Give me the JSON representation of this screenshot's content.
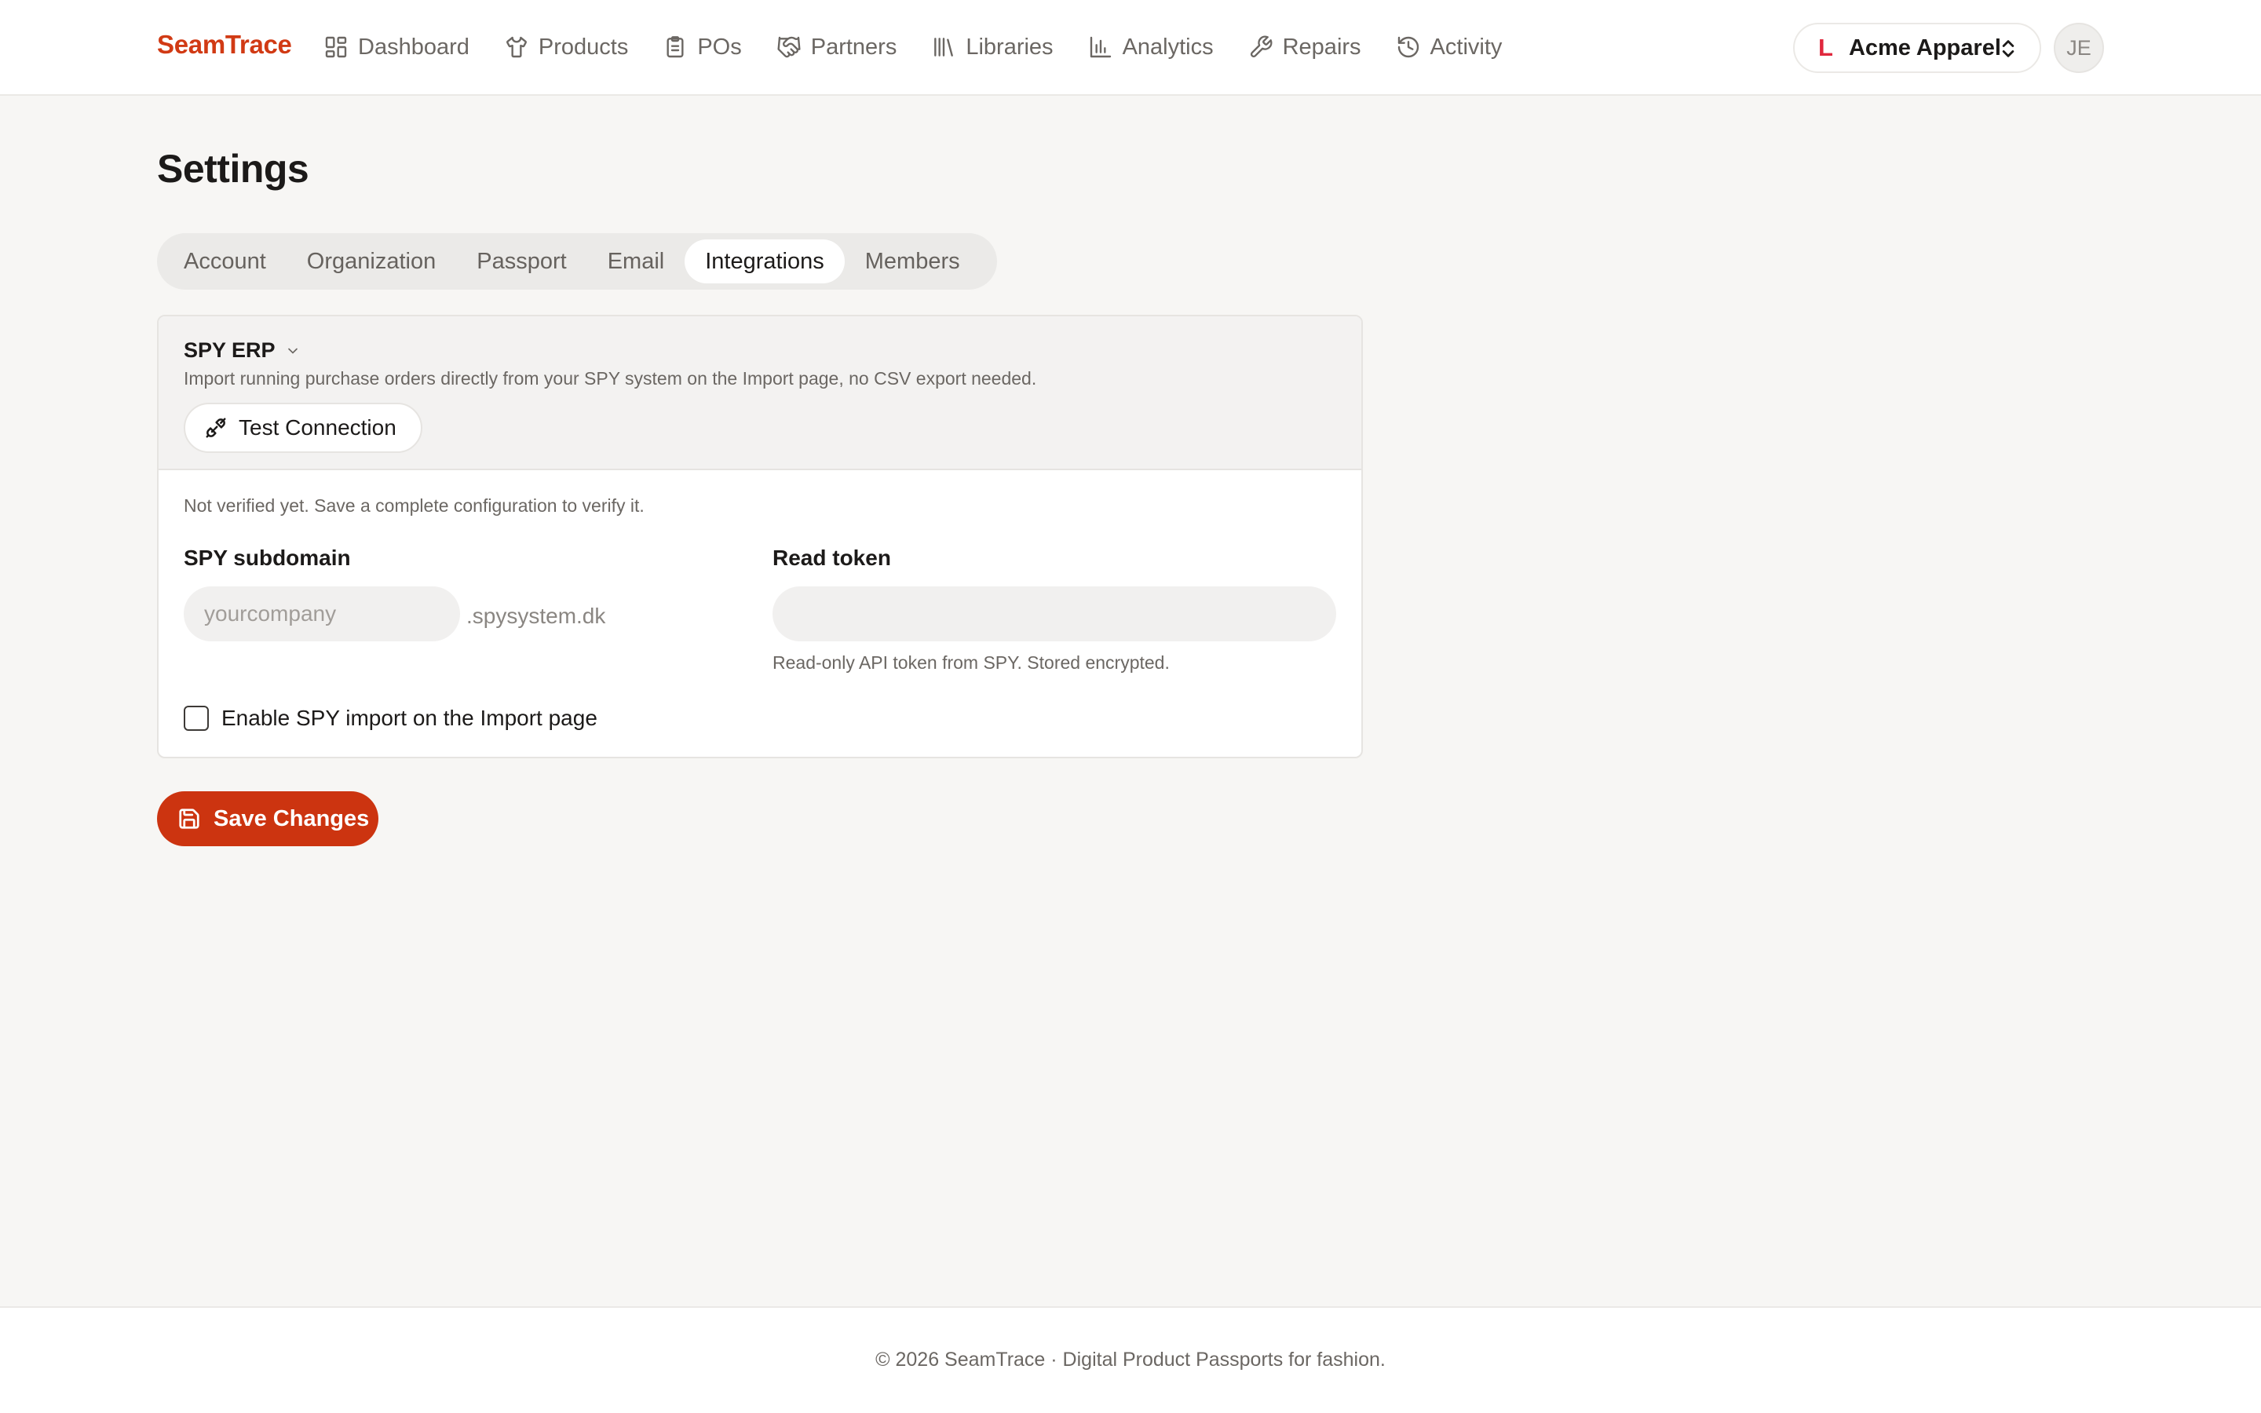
{
  "brand": {
    "name": "SeamTrace",
    "color": "#d13a14"
  },
  "nav": {
    "items": [
      {
        "label": "Dashboard",
        "icon": "dashboard-icon"
      },
      {
        "label": "Products",
        "icon": "shirt-icon"
      },
      {
        "label": "POs",
        "icon": "clipboard-icon"
      },
      {
        "label": "Partners",
        "icon": "handshake-icon"
      },
      {
        "label": "Libraries",
        "icon": "library-icon"
      },
      {
        "label": "Analytics",
        "icon": "bar-chart-icon"
      },
      {
        "label": "Repairs",
        "icon": "wrench-icon"
      },
      {
        "label": "Activity",
        "icon": "history-icon"
      }
    ]
  },
  "org": {
    "logo": "L",
    "name": "Acme Apparel"
  },
  "user": {
    "initials": "JE"
  },
  "page": {
    "title": "Settings"
  },
  "tabs": {
    "items": [
      {
        "label": "Account"
      },
      {
        "label": "Organization"
      },
      {
        "label": "Passport"
      },
      {
        "label": "Email"
      },
      {
        "label": "Integrations",
        "active": true
      },
      {
        "label": "Members"
      }
    ]
  },
  "integration": {
    "title": "SPY ERP",
    "description": "Import running purchase orders directly from your SPY system on the Import page, no CSV export needed.",
    "test_button": "Test Connection",
    "verify_note": "Not verified yet. Save a complete configuration to verify it.",
    "subdomain": {
      "label": "SPY subdomain",
      "placeholder": "yourcompany",
      "value": "",
      "suffix": ".spysystem.dk"
    },
    "token": {
      "label": "Read token",
      "placeholder": "",
      "value": "",
      "help": "Read-only API token from SPY. Stored encrypted."
    },
    "enable": {
      "label": "Enable SPY import on the Import page",
      "checked": false
    }
  },
  "save_button": "Save Changes",
  "accent_color": "#cc3410",
  "footer": {
    "text": "© 2026 SeamTrace · Digital Product Passports for fashion."
  }
}
